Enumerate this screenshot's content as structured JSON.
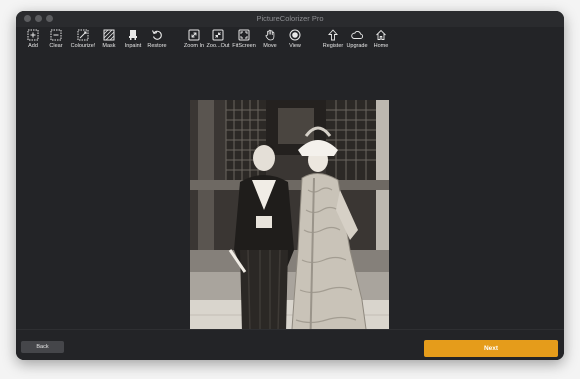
{
  "window": {
    "title": "PictureColorizer Pro"
  },
  "toolbar": {
    "tools": [
      {
        "label": "Add",
        "icon": "add-icon"
      },
      {
        "label": "Clear",
        "icon": "clear-icon"
      },
      {
        "label": "Colourize!",
        "icon": "colourize-icon"
      },
      {
        "label": "Mask",
        "icon": "mask-icon"
      },
      {
        "label": "Inpaint",
        "icon": "inpaint-icon"
      },
      {
        "label": "Restore",
        "icon": "restore-icon"
      },
      {
        "label": "Zoom In",
        "icon": "zoom-in-icon"
      },
      {
        "label": "Zoo...Out",
        "icon": "zoom-out-icon"
      },
      {
        "label": "FitScreen",
        "icon": "fit-screen-icon"
      },
      {
        "label": "Move",
        "icon": "hand-icon"
      },
      {
        "label": "View",
        "icon": "view-icon"
      },
      {
        "label": "Register",
        "icon": "upload-arrow-icon"
      },
      {
        "label": "Upgrade",
        "icon": "cloud-icon"
      },
      {
        "label": "Home",
        "icon": "home-icon"
      }
    ]
  },
  "footer": {
    "back_label": "Back",
    "next_label": "Next"
  },
  "colors": {
    "window_bg": "#232427",
    "next_button": "#e59c1b",
    "back_button": "#45464a"
  }
}
